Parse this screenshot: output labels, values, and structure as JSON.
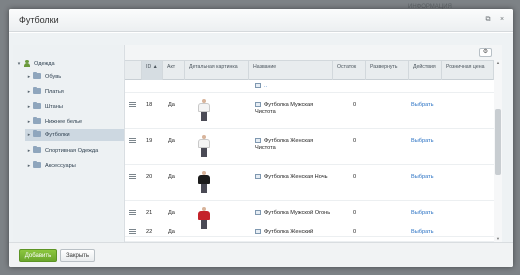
{
  "backdrop": {
    "fragment": "ИНФОРМАЦИЯ"
  },
  "dialog": {
    "title": "Футболки",
    "controls": {
      "expand": "⧉",
      "close": "×"
    }
  },
  "tree": {
    "root": {
      "label": "Одежда"
    },
    "items": [
      {
        "label": "Обувь"
      },
      {
        "label": "Платья"
      },
      {
        "label": "Штаны"
      },
      {
        "label": "Нижнее белье"
      },
      {
        "label": "Футболки",
        "selected": true
      },
      {
        "label": "Спортивная Одежда"
      },
      {
        "label": "Аксессуары"
      }
    ]
  },
  "grid": {
    "settings_icon": "gear-icon",
    "columns": {
      "id": "ID",
      "id_sort": "▲",
      "active": "Акт",
      "picture": "Детальная картинка",
      "name": "Название",
      "stock": "Остаток",
      "expand": "Развернуть",
      "action": "Действия",
      "price": "Розничная цена"
    },
    "parent_row": {
      "name": ".."
    },
    "rows": [
      {
        "id": "18",
        "active": "Да",
        "name": "Футболка Мужская Чистота",
        "stock": "0",
        "action": "Выбрать",
        "shirt_color": "#f4f4f4"
      },
      {
        "id": "19",
        "active": "Да",
        "name": "Футболка Женская Чистота",
        "stock": "0",
        "action": "Выбрать",
        "shirt_color": "#f4f4f4"
      },
      {
        "id": "20",
        "active": "Да",
        "name": "Футболка Женская Ночь",
        "stock": "0",
        "action": "Выбрать",
        "shirt_color": "#1c1c1c"
      },
      {
        "id": "21",
        "active": "Да",
        "name": "Футболка Мужской Огонь",
        "stock": "0",
        "action": "Выбрать",
        "shirt_color": "#c4232a"
      },
      {
        "id": "22",
        "active": "Да",
        "name": "Футболка Женский",
        "stock": "0",
        "action": "Выбрать",
        "shirt_color": "#e9e9e9"
      }
    ]
  },
  "footer": {
    "add_label": "Добавить",
    "close_label": "Закрыть"
  },
  "colors": {
    "accent_green": "#7ab733",
    "link_blue": "#2a72c4"
  }
}
